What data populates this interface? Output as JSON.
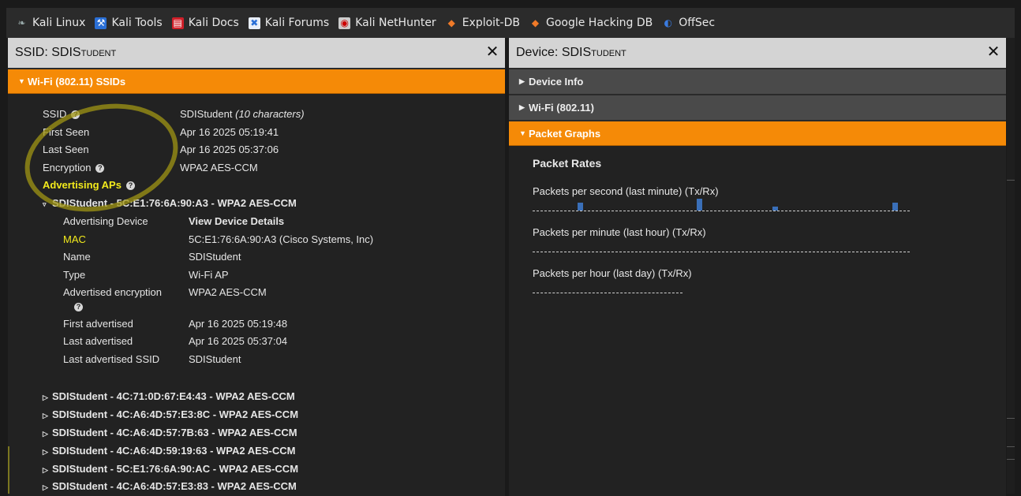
{
  "bookmarks": [
    {
      "label": "Kali Linux",
      "icon": "kali-dragon-icon"
    },
    {
      "label": "Kali Tools",
      "icon": "kali-tools-icon"
    },
    {
      "label": "Kali Docs",
      "icon": "kali-docs-icon"
    },
    {
      "label": "Kali Forums",
      "icon": "kali-forums-icon"
    },
    {
      "label": "Kali NetHunter",
      "icon": "kali-nethunter-icon"
    },
    {
      "label": "Exploit-DB",
      "icon": "exploit-db-icon"
    },
    {
      "label": "Google Hacking DB",
      "icon": "ghdb-icon"
    },
    {
      "label": "OffSec",
      "icon": "offsec-icon"
    }
  ],
  "left_panel": {
    "title_prefix": "SSID: ",
    "title_name": "SDIStudent",
    "section": "Wi-Fi (802.11) SSIDs",
    "fields": {
      "ssid_label": "SSID",
      "ssid_value": "SDIStudent",
      "ssid_note": "(10 characters)",
      "first_seen_label": "First Seen",
      "first_seen_value": "Apr 16 2025 05:19:41",
      "last_seen_label": "Last Seen",
      "last_seen_value": "Apr 16 2025 05:37:06",
      "encryption_label": "Encryption",
      "encryption_value": "WPA2 AES-CCM",
      "advertising_aps_label": "Advertising APs"
    },
    "expanded_ap": {
      "title": "SDIStudent - 5C:E1:76:6A:90:A3 - WPA2 AES-CCM",
      "advertising_device_label": "Advertising Device",
      "advertising_device_link": "View Device Details",
      "mac_label": "MAC",
      "mac_value": "5C:E1:76:6A:90:A3 (Cisco Systems, Inc)",
      "name_label": "Name",
      "name_value": "SDIStudent",
      "type_label": "Type",
      "type_value": "Wi-Fi AP",
      "adv_enc_label": "Advertised encryption",
      "adv_enc_value": "WPA2 AES-CCM",
      "first_adv_label": "First advertised",
      "first_adv_value": "Apr 16 2025 05:19:48",
      "last_adv_label": "Last advertised",
      "last_adv_value": "Apr 16 2025 05:37:04",
      "last_adv_ssid_label": "Last advertised SSID",
      "last_adv_ssid_value": "SDIStudent"
    },
    "collapsed_aps": [
      "SDIStudent - 4C:71:0D:67:E4:43 - WPA2 AES-CCM",
      "SDIStudent - 4C:A6:4D:57:E3:8C - WPA2 AES-CCM",
      "SDIStudent - 4C:A6:4D:57:7B:63 - WPA2 AES-CCM",
      "SDIStudent - 4C:A6:4D:59:19:63 - WPA2 AES-CCM",
      "SDIStudent - 5C:E1:76:6A:90:AC - WPA2 AES-CCM",
      "SDIStudent - 4C:A6:4D:57:E3:83 - WPA2 AES-CCM"
    ]
  },
  "right_panel": {
    "title_prefix": "Device: ",
    "title_name": "SDIStudent",
    "sections": {
      "device_info": "Device Info",
      "wifi": "Wi-Fi (802.11)",
      "packet_graphs": "Packet Graphs"
    },
    "packet_rates_heading": "Packet Rates",
    "graphs": {
      "per_second": "Packets per second (last minute) (Tx/Rx)",
      "per_minute": "Packets per minute (last hour) (Tx/Rx)",
      "per_hour": "Packets per hour (last day) (Tx/Rx)"
    }
  },
  "colors": {
    "accent_orange": "#f58a07",
    "highlight_yellow": "#f2ea1c",
    "graph_bar": "#3a6fb8"
  }
}
